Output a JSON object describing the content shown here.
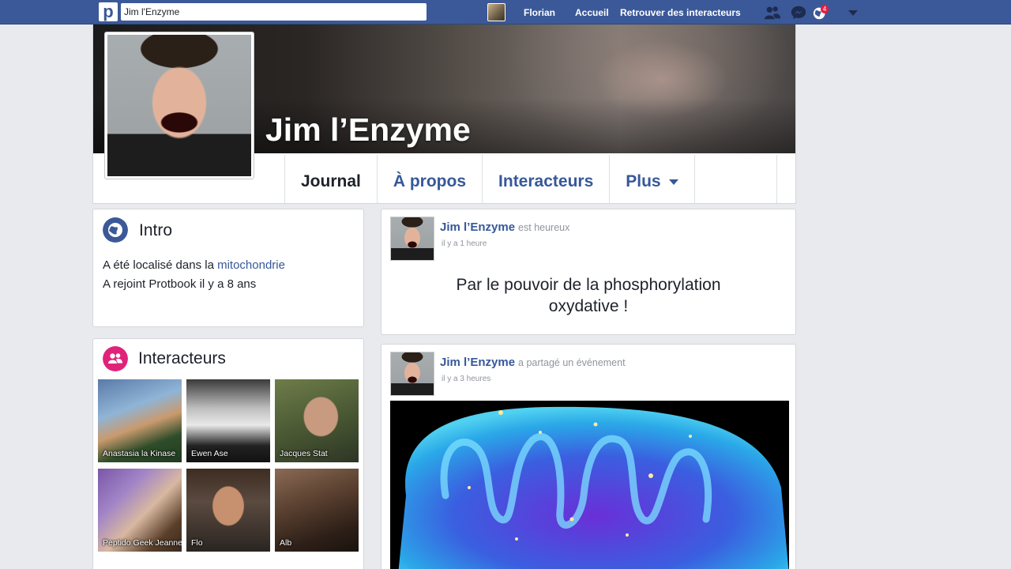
{
  "topbar": {
    "logo": "p",
    "search_value": "Jim l'Enzyme",
    "user_name": "Florian",
    "home": "Accueil",
    "find": "Retrouver des interacteurs",
    "notification_count": "4",
    "colors": {
      "bar": "#3b5998",
      "badge": "#e41e3f"
    }
  },
  "profile": {
    "name": "Jim l’Enzyme",
    "tabs": [
      {
        "label": "Journal"
      },
      {
        "label": "À propos"
      },
      {
        "label": "Interacteurs"
      },
      {
        "label": "Plus"
      }
    ]
  },
  "intro": {
    "title": "Intro",
    "line1_prefix": "A été localisé dans la ",
    "line1_link": "mitochondrie",
    "line2": "A rejoint Protbook il y a 8 ans"
  },
  "friends": {
    "title": "Interacteurs",
    "items": [
      {
        "name": "Anastasia la Kinase"
      },
      {
        "name": "Ewen Ase"
      },
      {
        "name": "Jacques Stat"
      },
      {
        "name": "Peptido Geek Jeanne"
      },
      {
        "name": "Flo"
      },
      {
        "name": "Alb"
      }
    ]
  },
  "posts": [
    {
      "author": "Jim l’Enzyme",
      "action": "est heureux",
      "time": "il y a 1 heure",
      "text_line1": "Par le pouvoir de la phosphorylation",
      "text_line2": "oxydative !"
    },
    {
      "author": "Jim l’Enzyme",
      "action": "a partagé un événement",
      "time": "il y a 3 heures"
    }
  ]
}
